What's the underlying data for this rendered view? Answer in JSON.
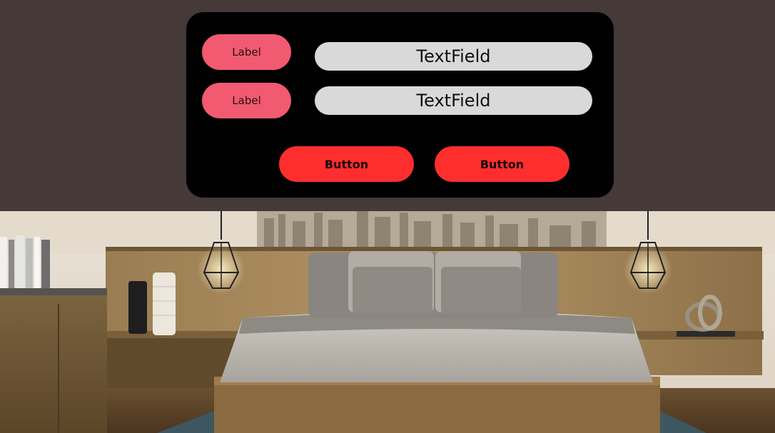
{
  "form": {
    "rows": [
      {
        "label": "Label",
        "field": "TextField"
      },
      {
        "label": "Label",
        "field": "TextField"
      }
    ],
    "buttons": [
      {
        "label": "Button"
      },
      {
        "label": "Button"
      }
    ]
  },
  "colors": {
    "page_background": "#453a38",
    "panel": "#000000",
    "label_pill": "#f15a70",
    "text_field": "#d9d9d9",
    "button": "#ff2e2e"
  },
  "background_image": {
    "icons": [
      "pendant-lamp-icon",
      "pendant-lamp-icon",
      "bed-icon",
      "vase-icon",
      "sculpture-icon",
      "books-icon"
    ]
  }
}
